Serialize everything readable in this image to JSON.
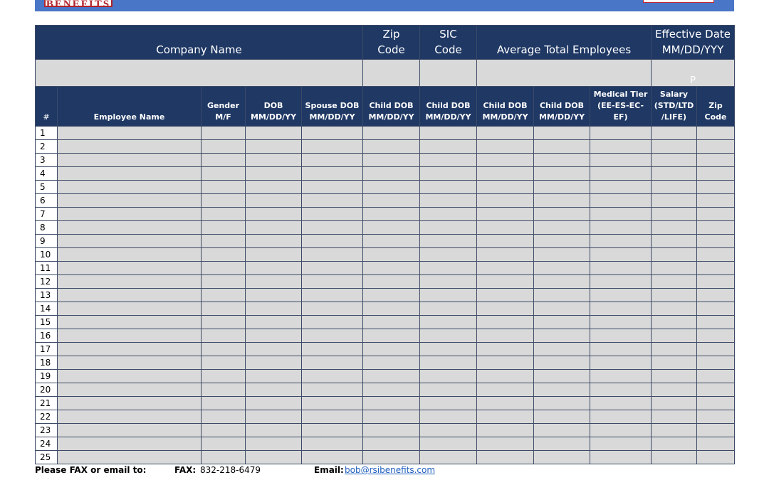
{
  "logo": {
    "text": "BENEFITS"
  },
  "company_table": {
    "headers": {
      "company_name": "Company Name",
      "zip_line1": "Zip",
      "zip_line2": "Code",
      "sic_line1": "SIC",
      "sic_line2": "Code",
      "avg_employees": "Average Total Employees",
      "effective_line1": "Effective Date",
      "effective_line2": "MM/DD/YYY"
    },
    "effective_value": "P"
  },
  "employee_table": {
    "headers": {
      "num": "#",
      "name": "Employee Name",
      "gender_l1": "Gender",
      "gender_l2": "M/F",
      "dob_l1": "DOB",
      "dob_l2": "MM/DD/YY",
      "spouse_l1": "Spouse DOB",
      "spouse_l2": "MM/DD/YY",
      "child1_l1": "Child DOB",
      "child1_l2": "MM/DD/YY",
      "child2_l1": "Child DOB",
      "child2_l2": "MM/DD/YY",
      "child3_l1": "Child DOB",
      "child3_l2": "MM/DD/YY",
      "child4_l1": "Child DOB",
      "child4_l2": "MM/DD/YY",
      "tier_l1": "Medical Tier",
      "tier_l2": "(EE-ES-EC-EF)",
      "salary_l1": "Salary",
      "salary_l2": "(STD/LTD",
      "salary_l3": "/LIFE)",
      "zip_l1": "Zip",
      "zip_l2": "Code"
    },
    "rows": [
      "1",
      "2",
      "3",
      "4",
      "5",
      "6",
      "7",
      "8",
      "9",
      "10",
      "11",
      "12",
      "13",
      "14",
      "15",
      "16",
      "17",
      "18",
      "19",
      "20",
      "21",
      "22",
      "23",
      "24",
      "25"
    ]
  },
  "footer": {
    "prompt": "Please FAX or email to:",
    "fax_label": "FAX:",
    "fax_number": "832-218-6479",
    "email_label": "Email:",
    "email_address": "bob@rsibenefits.com"
  },
  "colors": {
    "header_navy": "#1f3864",
    "cell_gray": "#d9d9d9",
    "top_bar_blue": "#4a76c7",
    "logo_red": "#b0242b"
  }
}
